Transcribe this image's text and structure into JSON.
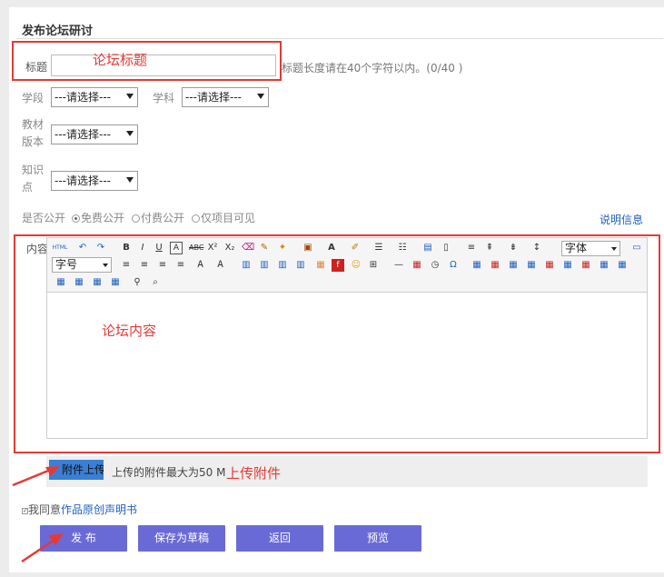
{
  "form": {
    "section_title": "发布论坛研讨",
    "title_label": "标题",
    "title_value": "",
    "title_hint": "标题长度请在40个字符以内。(0/40 )",
    "stage_label": "学段",
    "stage_value": "---请选择---",
    "subject_label": "学科",
    "subject_value": "---请选择---",
    "textbook_label_line1": "教材",
    "textbook_label_line2": "版本",
    "textbook_value": "---请选择---",
    "knowledge_label_line1": "知识",
    "knowledge_label_line2": "点",
    "knowledge_value": "---请选择---",
    "public_label": "是否公开",
    "radio_free": "免费公开",
    "radio_paid": "付费公开",
    "radio_project": "仅项目可见",
    "info_link": "说明信息",
    "content_label": "内容",
    "toolbar_font": "字体",
    "toolbar_size": "字号",
    "upload_button": "附件上传",
    "upload_hint": "上传的附件最大为50 M",
    "agree_prefix": "我同意",
    "agree_link": "作品原创声明书"
  },
  "annotations": {
    "title": "论坛标题",
    "content": "论坛内容",
    "upload": "上传附件"
  },
  "buttons": {
    "publish": "发 布",
    "save_draft": "保存为草稿",
    "back": "返回",
    "preview": "预览"
  },
  "colors": {
    "annotation_red": "#e53935",
    "button_purple": "#6a6ad6",
    "link_blue": "#1f5fbf"
  }
}
